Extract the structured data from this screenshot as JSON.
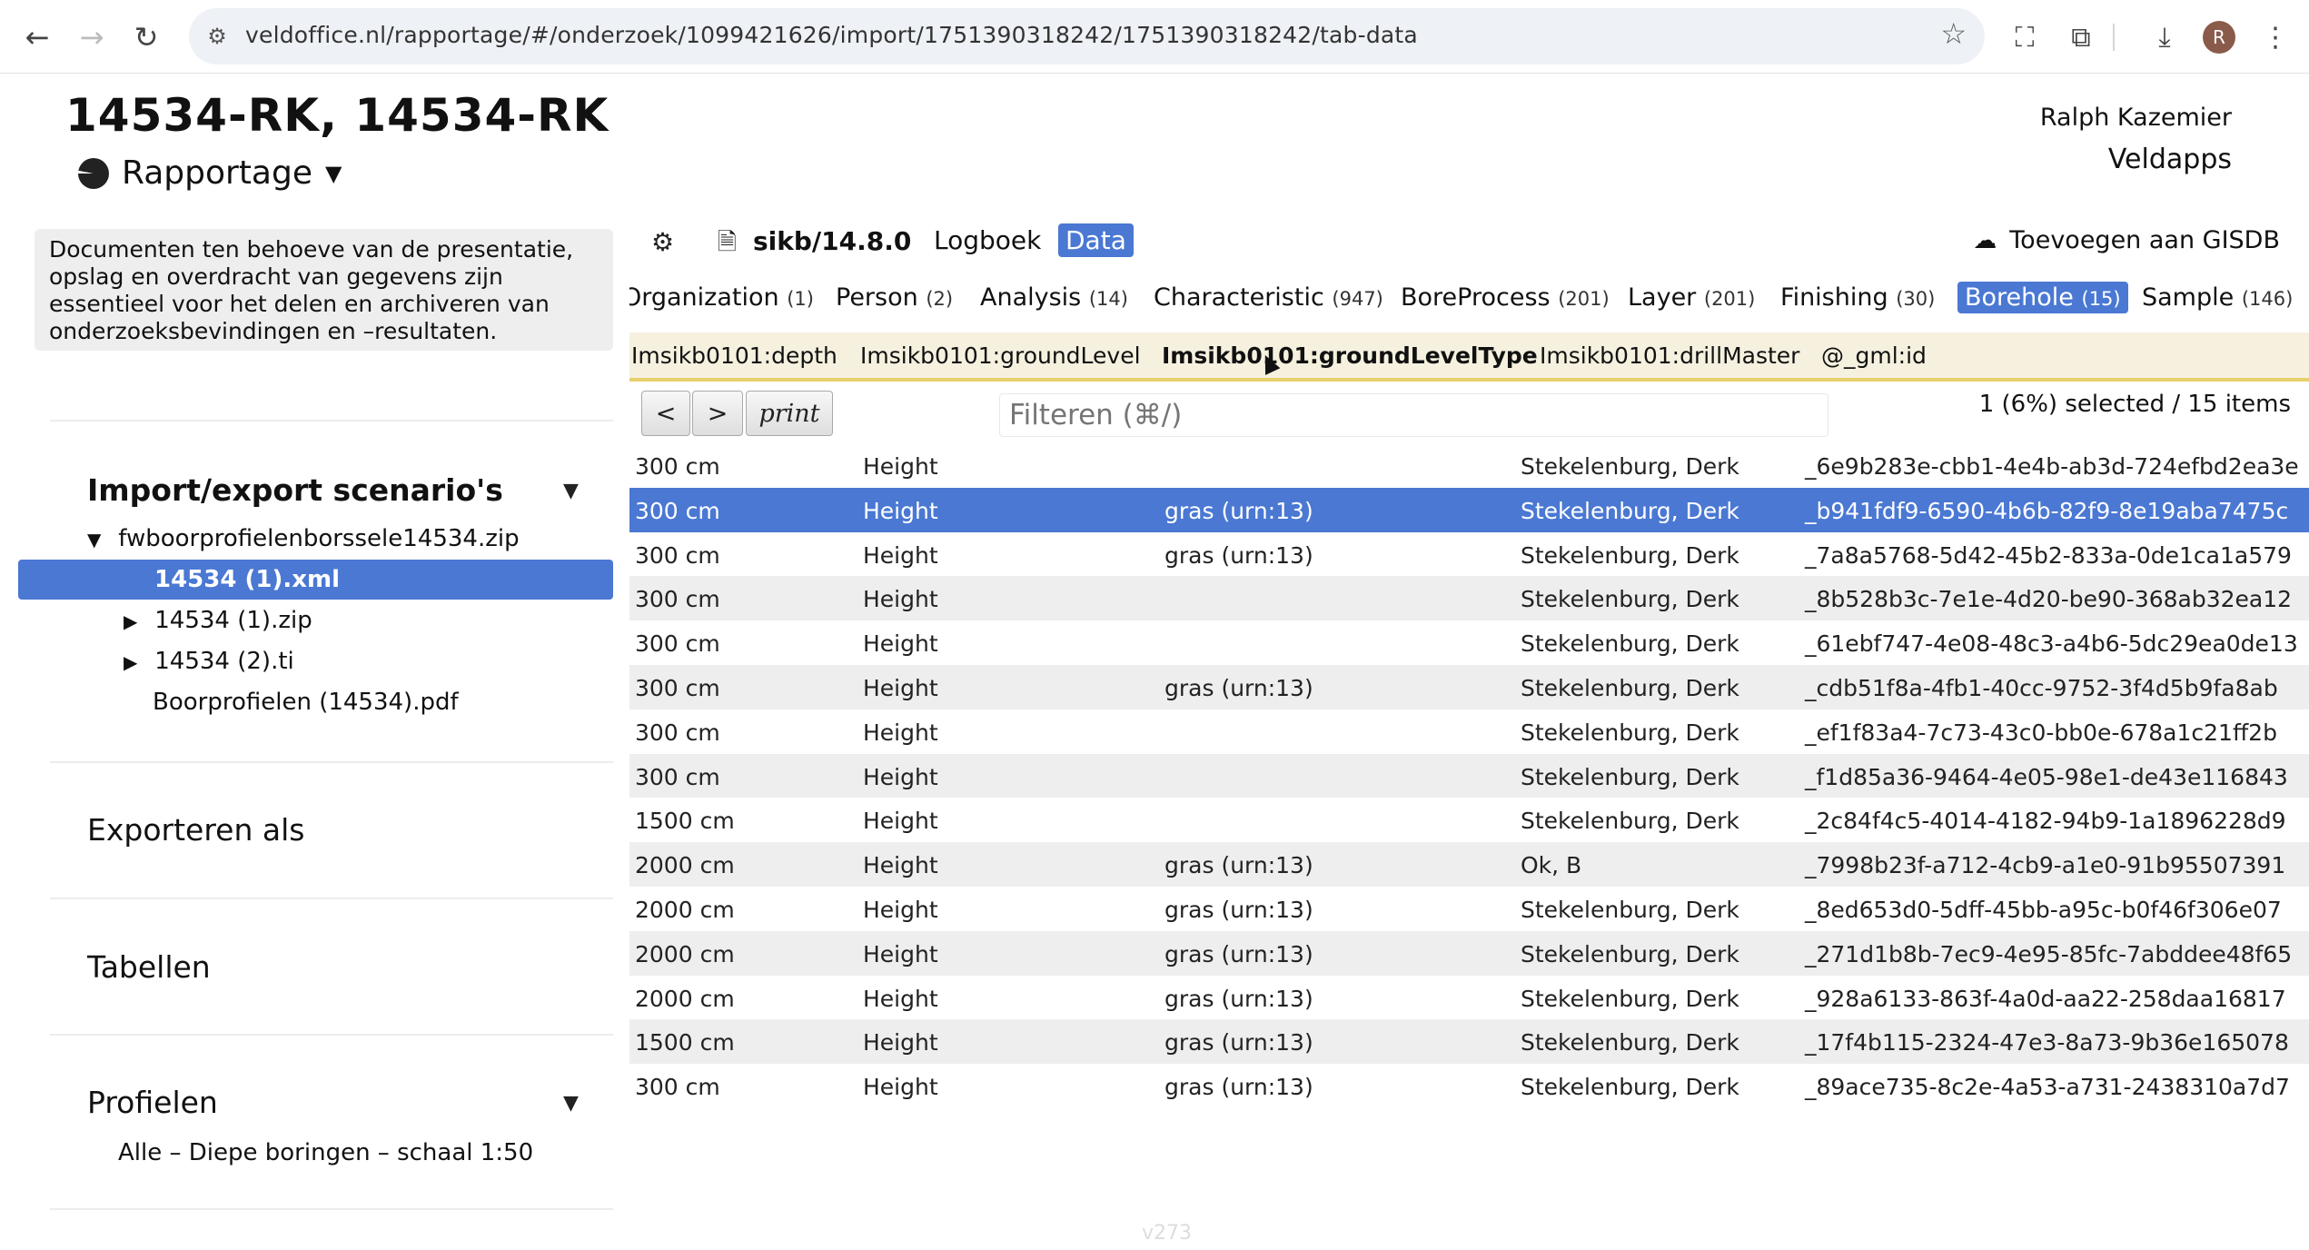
{
  "browser": {
    "url": "veldoffice.nl/rapportage/#/onderzoek/1099421626/import/1751390318242/1751390318242/tab-data",
    "avatar_letter": "R"
  },
  "app": {
    "title": "14534-RK, 14534-RK",
    "menu_label": "Rapportage",
    "user_name": "Ralph Kazemier",
    "user_app": "Veldapps"
  },
  "sidebar": {
    "info_text": "Documenten ten behoeve van de presentatie, opslag en overdracht van gegevens zijn essentieel voor het delen en archiveren van onderzoeksbevindingen en –resultaten.",
    "import_title": "Import/export scenario's",
    "tree": {
      "root": "fwboorprofielenborssele14534.zip",
      "selected": "14534 (1).xml",
      "items": [
        "14534 (1).zip",
        "14534 (2).ti",
        "Boorprofielen (14534).pdf"
      ]
    },
    "export_title": "Exporteren als",
    "tables_title": "Tabellen",
    "profiles_title": "Profielen",
    "profile_item": "Alle – Diepe boringen – schaal 1:50"
  },
  "toolbar": {
    "schema": "sikb/14.8.0",
    "tab_log": "Logboek",
    "tab_data": "Data",
    "gisdb_label": "Toevoegen aan GISDB"
  },
  "entity_tabs": [
    {
      "label": "Organization",
      "count": "(1)"
    },
    {
      "label": "Person",
      "count": "(2)"
    },
    {
      "label": "Analysis",
      "count": "(14)"
    },
    {
      "label": "Characteristic",
      "count": "(947)"
    },
    {
      "label": "BoreProcess",
      "count": "(201)"
    },
    {
      "label": "Layer",
      "count": "(201)"
    },
    {
      "label": "Finishing",
      "count": "(30)"
    },
    {
      "label": "Borehole",
      "count": "(15)"
    },
    {
      "label": "Sample",
      "count": "(146)"
    }
  ],
  "columns": [
    "Imsikb0101:depth",
    "Imsikb0101:groundLevel",
    "Imsikb0101:groundLevelType",
    "Imsikb0101:drillMaster",
    "@_gml:id"
  ],
  "pager": {
    "prev": "<",
    "next": ">",
    "print": "print"
  },
  "filter": {
    "placeholder": "Filteren (⌘/)"
  },
  "selection_info": "1 (6%) selected / 15 items",
  "rows": [
    [
      "300 cm",
      "Height",
      "",
      "Stekelenburg, Derk",
      "_6e9b283e-cbb1-4e4b-ab3d-724efbd2ea3e"
    ],
    [
      "300 cm",
      "Height",
      "gras (urn:13)",
      "Stekelenburg, Derk",
      "_b941fdf9-6590-4b6b-82f9-8e19aba7475c"
    ],
    [
      "300 cm",
      "Height",
      "gras (urn:13)",
      "Stekelenburg, Derk",
      "_7a8a5768-5d42-45b2-833a-0de1ca1a579"
    ],
    [
      "300 cm",
      "Height",
      "",
      "Stekelenburg, Derk",
      "_8b528b3c-7e1e-4d20-be90-368ab32ea12"
    ],
    [
      "300 cm",
      "Height",
      "",
      "Stekelenburg, Derk",
      "_61ebf747-4e08-48c3-a4b6-5dc29ea0de13"
    ],
    [
      "300 cm",
      "Height",
      "gras (urn:13)",
      "Stekelenburg, Derk",
      "_cdb51f8a-4fb1-40cc-9752-3f4d5b9fa8ab"
    ],
    [
      "300 cm",
      "Height",
      "",
      "Stekelenburg, Derk",
      "_ef1f83a4-7c73-43c0-bb0e-678a1c21ff2b"
    ],
    [
      "300 cm",
      "Height",
      "",
      "Stekelenburg, Derk",
      "_f1d85a36-9464-4e05-98e1-de43e116843"
    ],
    [
      "1500 cm",
      "Height",
      "",
      "Stekelenburg, Derk",
      "_2c84f4c5-4014-4182-94b9-1a1896228d9"
    ],
    [
      "2000 cm",
      "Height",
      "gras (urn:13)",
      "Ok, B",
      "_7998b23f-a712-4cb9-a1e0-91b95507391"
    ],
    [
      "2000 cm",
      "Height",
      "gras (urn:13)",
      "Stekelenburg, Derk",
      "_8ed653d0-5dff-45bb-a95c-b0f46f306e07"
    ],
    [
      "2000 cm",
      "Height",
      "gras (urn:13)",
      "Stekelenburg, Derk",
      "_271d1b8b-7ec9-4e95-85fc-7abddee48f65"
    ],
    [
      "2000 cm",
      "Height",
      "gras (urn:13)",
      "Stekelenburg, Derk",
      "_928a6133-863f-4a0d-aa22-258daa16817"
    ],
    [
      "1500 cm",
      "Height",
      "gras (urn:13)",
      "Stekelenburg, Derk",
      "_17f4b115-2324-47e3-8a73-9b36e165078"
    ],
    [
      "300 cm",
      "Height",
      "gras (urn:13)",
      "Stekelenburg, Derk",
      "_89ace735-8c2e-4a53-a731-2438310a7d7"
    ]
  ],
  "selected_row_index": 1,
  "version": "v273",
  "colors": {
    "accent": "#4a78d3",
    "header_strip": "#f6f1df",
    "header_underline": "#e8cf6a"
  }
}
